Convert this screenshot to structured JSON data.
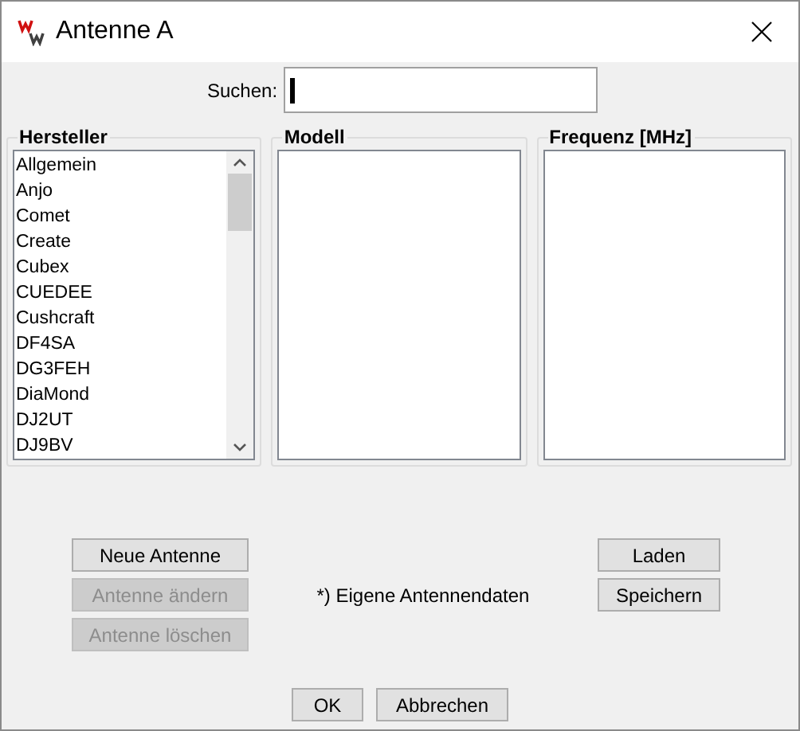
{
  "window": {
    "title": "Antenne A"
  },
  "search": {
    "label": "Suchen:"
  },
  "panels": [
    {
      "title": "Hersteller",
      "items": [
        "Allgemein",
        "Anjo",
        "Comet",
        "Create",
        "Cubex",
        "CUEDEE",
        "Cushcraft",
        "DF4SA",
        "DG3FEH",
        "DiaMond",
        "DJ2UT",
        "DJ9BV"
      ]
    },
    {
      "title": "Modell"
    },
    {
      "title": "Frequenz [MHz]"
    }
  ],
  "left_buttons": [
    {
      "label": "Neue Antenne",
      "disabled": false
    },
    {
      "label": "Antenne ändern",
      "disabled": true
    },
    {
      "label": "Antenne löschen",
      "disabled": true
    }
  ],
  "note": "*) Eigene Antennendaten",
  "right_buttons": [
    {
      "label": "Laden",
      "disabled": false
    },
    {
      "label": "Speichern",
      "disabled": false
    }
  ],
  "dialog_buttons": [
    {
      "label": "OK",
      "disabled": false
    },
    {
      "label": "Abbrechen",
      "disabled": false
    }
  ]
}
